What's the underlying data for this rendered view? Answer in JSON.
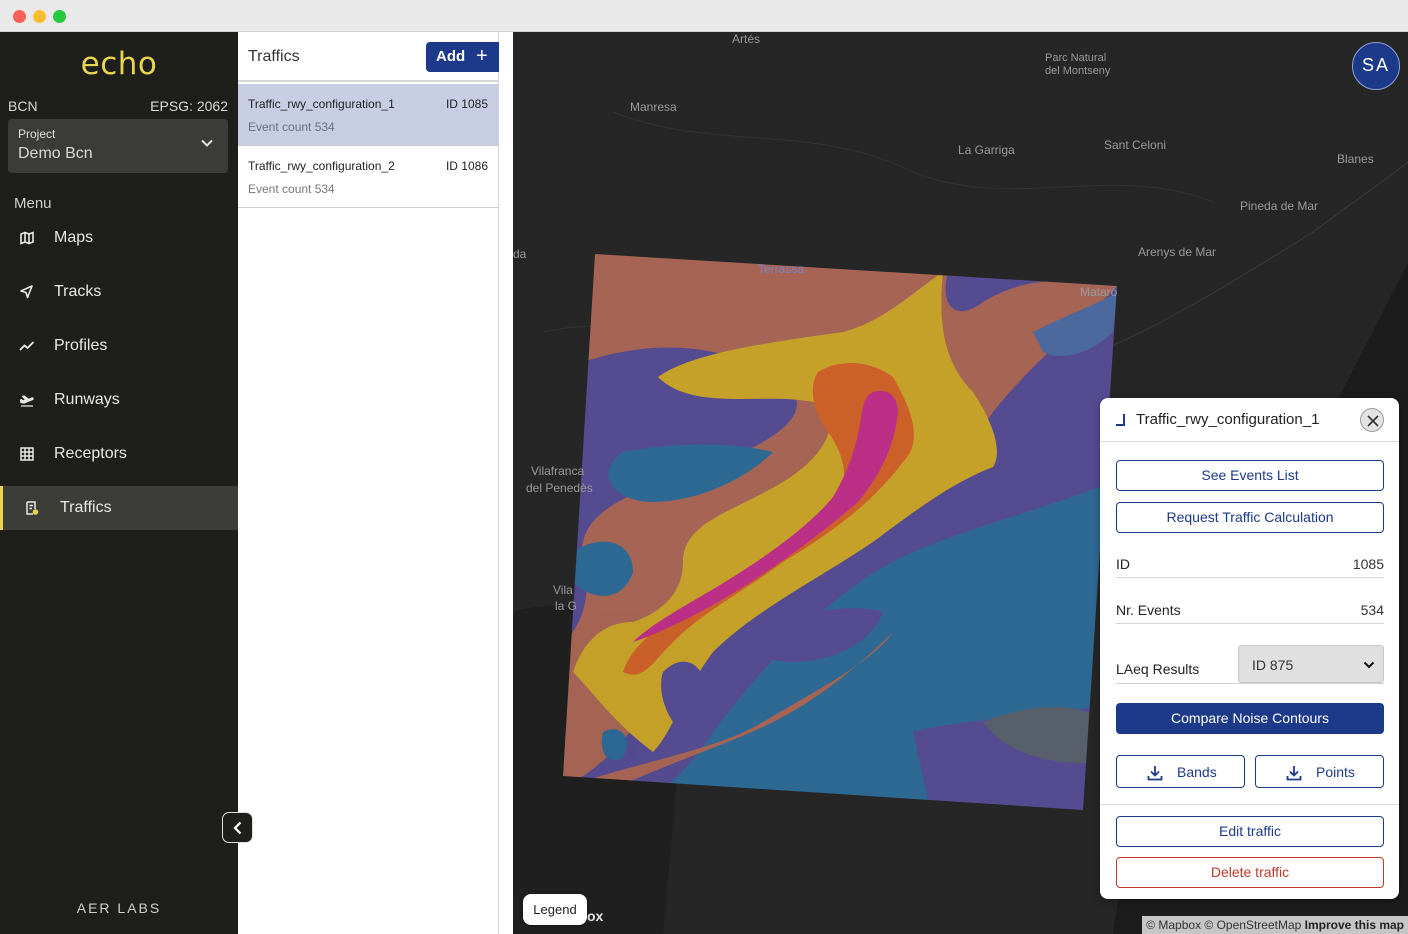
{
  "app": {
    "logo": "echo",
    "region": "BCN",
    "epsg": "EPSG: 2062",
    "project_label": "Project",
    "project_value": "Demo Bcn",
    "menu_title": "Menu",
    "company": "AER LABS"
  },
  "nav": [
    {
      "label": "Maps",
      "icon": "map-icon"
    },
    {
      "label": "Tracks",
      "icon": "navigation-arrow-icon"
    },
    {
      "label": "Profiles",
      "icon": "trend-line-icon"
    },
    {
      "label": "Runways",
      "icon": "airplane-takeoff-icon"
    },
    {
      "label": "Receptors",
      "icon": "grid-icon"
    },
    {
      "label": "Traffics",
      "icon": "traffic-list-icon",
      "active": true
    }
  ],
  "traffics_panel": {
    "title": "Traffics",
    "add_label": "Add",
    "items": [
      {
        "name": "Traffic_rwy_configuration_1",
        "id": "ID 1085",
        "events": "Event count 534",
        "selected": true
      },
      {
        "name": "Traffic_rwy_configuration_2",
        "id": "ID 1086",
        "events": "Event count 534",
        "selected": false
      }
    ]
  },
  "map": {
    "places": [
      "Artés",
      "Parc Natural",
      "del Montseny",
      "Manresa",
      "La Garriga",
      "Sant Celoni",
      "Blanes",
      "Pineda de Mar",
      "Arenys de Mar",
      "Mataró",
      "Terrassa",
      "Vilafranca",
      "del Penedès",
      "Vila",
      "la G",
      "da",
      "ox"
    ],
    "avatar_initials": "SA",
    "legend_label": "Legend",
    "attribution_1": "© Mapbox © OpenStreetMap",
    "attribution_2": "Improve this map"
  },
  "detail": {
    "title": "Traffic_rwy_configuration_1",
    "see_events": "See Events List",
    "request_calc": "Request Traffic Calculation",
    "id_label": "ID",
    "id_value": "1085",
    "events_label": "Nr. Events",
    "events_value": "534",
    "laeq_label": "LAeq Results",
    "laeq_value": "ID 875",
    "compare": "Compare Noise Contours",
    "bands": "Bands",
    "points": "Points",
    "edit": "Edit traffic",
    "delete": "Delete traffic"
  },
  "colors": {
    "brand_blue": "#1d3a8a",
    "logo_yellow": "#e8d44d",
    "sidebar_bg": "#1e1e1b",
    "contour_band_1": "#2f6f9e",
    "contour_band_2": "#5a4f9b",
    "contour_band_3": "#b06a58",
    "contour_band_4": "#d4ac2a",
    "contour_band_5": "#d9662a",
    "contour_band_6": "#c8318f",
    "danger_red": "#c0392b"
  }
}
